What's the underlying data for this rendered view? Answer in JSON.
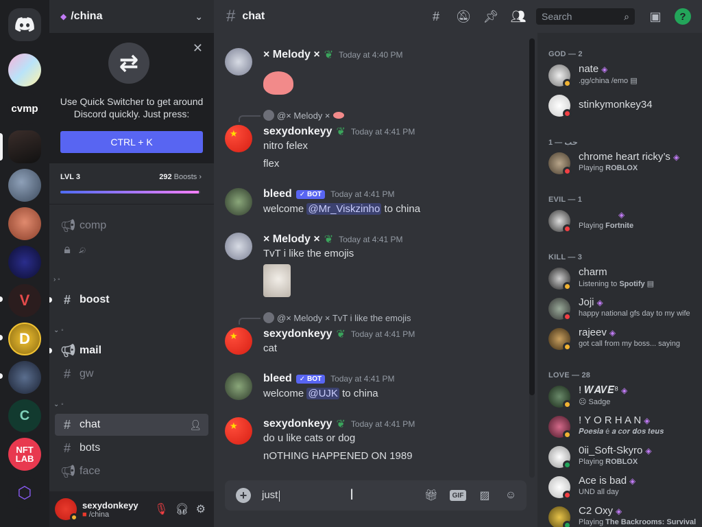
{
  "server": {
    "name": "/china"
  },
  "quick_switcher": {
    "text_line1": "Use Quick Switcher to get around",
    "text_line2": "Discord quickly. Just press:",
    "button": "CTRL + K"
  },
  "boost": {
    "level": "LVL 3",
    "count": "292",
    "count_suffix": "Boosts",
    "progress": 0.99
  },
  "rail": {
    "cvmp": "cvmp",
    "nftlab_1": "NFT",
    "nftlab_2": "LAB"
  },
  "channels": [
    {
      "name": "comp",
      "icon": "megaphone"
    },
    {
      "name": "𐨆𐨆𐨆",
      "icon": "lock"
    },
    {
      "name": "boost",
      "icon": "hash"
    },
    {
      "name": "mail",
      "icon": "megaphone"
    },
    {
      "name": "gw",
      "icon": "hash"
    },
    {
      "name": "chat",
      "icon": "hash"
    },
    {
      "name": "bots",
      "icon": "hash"
    },
    {
      "name": "face",
      "icon": "megaphone"
    }
  ],
  "user": {
    "name": "sexydonkeyy",
    "status": "/china"
  },
  "channel": {
    "name": "chat"
  },
  "search": {
    "placeholder": "Search"
  },
  "messages": [
    {
      "author": "× Melody ×",
      "time": "Today at 4:40 PM"
    },
    {
      "reply": "@× Melody ×",
      "author": "sexydonkeyy",
      "time": "Today at 4:41 PM",
      "lines": [
        "nitro felex",
        "flex"
      ]
    },
    {
      "author": "bleed",
      "badge": "BOT",
      "time": "Today at 4:41 PM",
      "pre": "welcome ",
      "mention": "@Mr_Viskzinho",
      "post": " to china"
    },
    {
      "author": "× Melody ×",
      "time": "Today at 4:41 PM",
      "lines": [
        "TvT  i like the emojis"
      ]
    },
    {
      "reply": "@× Melody ×  TvT  i like the emojis",
      "author": "sexydonkeyy",
      "time": "Today at 4:41 PM",
      "lines": [
        "cat"
      ]
    },
    {
      "author": "bleed",
      "badge": "BOT",
      "time": "Today at 4:41 PM",
      "pre": "welcome ",
      "mention": "@UJK",
      "post": " to china"
    },
    {
      "author": "sexydonkeyy",
      "time": "Today at 4:41 PM",
      "lines": [
        "do u like cats or dog",
        "nOTHING HAPPENED ON 1989"
      ]
    }
  ],
  "composer": {
    "value": "just"
  },
  "members": {
    "groups": [
      {
        "label": "GOD — 2"
      },
      {
        "label": "حب — 1"
      },
      {
        "label": "EVIL — 1"
      },
      {
        "label": "KILL — 3"
      },
      {
        "label": "LOVE — 28"
      }
    ],
    "list": [
      {
        "name": "nate",
        "status": ".gg/china /emo"
      },
      {
        "name": "stinkymonkey34",
        "status": ""
      },
      {
        "name": "chrome heart ricky’s",
        "status_pre": "Playing ",
        "status_bold": "ROBLOX"
      },
      {
        "name": "",
        "status_pre": "Playing ",
        "status_bold": "Fortnite"
      },
      {
        "name": "charm",
        "status_pre": "Listening to ",
        "status_bold": "Spotify"
      },
      {
        "name": "Joji",
        "status": "happy national gfs day to my wife"
      },
      {
        "name": "rajeev",
        "status": "got call from my boss... saying"
      },
      {
        "name": "! 𝑾𝑨𝑽𝑬⁸",
        "status": "Sadge"
      },
      {
        "name": "! Y O R H A N",
        "status": "𝑷𝒐𝒆𝒔𝒊𝒂 é 𝒂 𝒄𝒐𝒓 𝒅𝒐𝒔 𝒕𝒆𝒖𝒔"
      },
      {
        "name": "0ii_Soft-Skyro",
        "status_pre": "Playing ",
        "status_bold": "ROBLOX"
      },
      {
        "name": "Ace is bad",
        "status": "UND all day"
      },
      {
        "name": "C2 Oxy",
        "status_pre": "Playing ",
        "status_bold": "The Backrooms: Survival"
      }
    ]
  },
  "colors": {
    "blurple": "#5865f2",
    "bg": "#313338",
    "sidebar": "#2b2d31",
    "rail": "#1e1f22",
    "online": "#23a55a",
    "idle": "#f0b232",
    "dnd": "#f23f43",
    "nitro": "#c27cf7"
  }
}
